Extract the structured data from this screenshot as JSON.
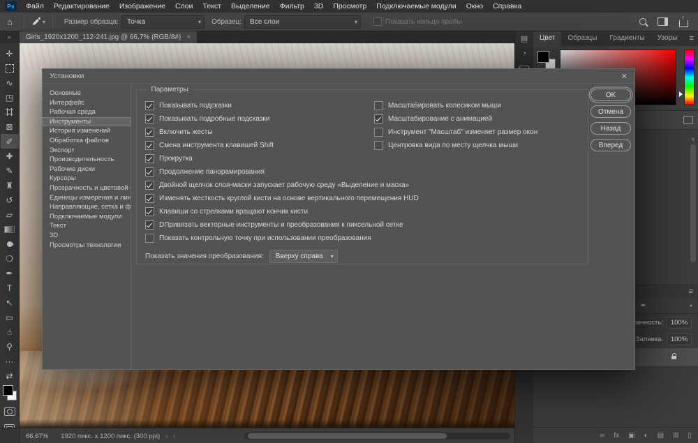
{
  "colors": {
    "accent_blue": "#34a9ff",
    "dialog_bg": "#535353",
    "selection_red": "#ff0000"
  },
  "icons": {
    "home": "⌂",
    "dropdown_arrow": "▾",
    "hamburger": "≡",
    "tab_overflow": "»",
    "scroll_up": "∧",
    "chevron_right": "›",
    "chevron_left": "‹",
    "dock_icon_1": "▤",
    "dock_icon_2": "◔",
    "filter_pin": "●"
  },
  "menu_bar": {
    "logo": "Ps",
    "items": [
      {
        "name": "menu-file",
        "label": "Файл"
      },
      {
        "name": "menu-edit",
        "label": "Редактирование"
      },
      {
        "name": "menu-image",
        "label": "Изображение"
      },
      {
        "name": "menu-layers",
        "label": "Слои"
      },
      {
        "name": "menu-type",
        "label": "Текст"
      },
      {
        "name": "menu-select",
        "label": "Выделение"
      },
      {
        "name": "menu-filter",
        "label": "Фильтр"
      },
      {
        "name": "menu-3d",
        "label": "3D"
      },
      {
        "name": "menu-view",
        "label": "Просмотр"
      },
      {
        "name": "menu-plugins",
        "label": "Подключаемые модули"
      },
      {
        "name": "menu-window",
        "label": "Окно"
      },
      {
        "name": "menu-help",
        "label": "Справка"
      }
    ]
  },
  "options_bar": {
    "sample_size_label": "Размер образца:",
    "sample_size_value": "Точка",
    "sample_label": "Образец:",
    "sample_value": "Все слои",
    "show_ring_label": "Показать кольцо пробы"
  },
  "tab_bar": {
    "document_title": "Girls_1920x1200_112-241.jpg @ 66,7% (RGB/8#)",
    "close": "×"
  },
  "toolbar": {
    "tools": [
      {
        "name": "move-tool",
        "glyph": "✛"
      },
      {
        "name": "marquee-tool",
        "glyph": "",
        "cls": "i-marquee"
      },
      {
        "name": "lasso-tool",
        "glyph": "∿"
      },
      {
        "name": "object-selection-tool",
        "glyph": "◳"
      },
      {
        "name": "crop-tool",
        "glyph": "",
        "cls": "i-crop"
      },
      {
        "name": "frame-tool",
        "glyph": "⊠"
      },
      {
        "name": "eyedropper-tool",
        "glyph": "✐",
        "active": true
      },
      {
        "name": "healing-brush-tool",
        "glyph": "✚"
      },
      {
        "name": "brush-tool",
        "glyph": "✎"
      },
      {
        "name": "clone-stamp-tool",
        "glyph": "♜"
      },
      {
        "name": "history-brush-tool",
        "glyph": "↺"
      },
      {
        "name": "eraser-tool",
        "glyph": "▱"
      },
      {
        "name": "gradient-tool",
        "glyph": "",
        "cls": "i-gradient"
      },
      {
        "name": "blur-tool",
        "glyph": "",
        "cls": "i-droplet"
      },
      {
        "name": "dodge-tool",
        "glyph": "❍"
      },
      {
        "name": "pen-tool",
        "glyph": "✒"
      },
      {
        "name": "type-tool",
        "glyph": "T"
      },
      {
        "name": "path-selection-tool",
        "glyph": "↖"
      },
      {
        "name": "shape-tool",
        "glyph": "▭"
      },
      {
        "name": "hand-tool",
        "glyph": "☝"
      },
      {
        "name": "zoom-tool",
        "glyph": "⚲"
      },
      {
        "name": "more-tools",
        "glyph": "···",
        "cls": "i-small"
      },
      {
        "name": "swap-colors",
        "glyph": "⇄",
        "cls": "i-small"
      }
    ]
  },
  "dialog": {
    "title": "Установки",
    "close": "✕",
    "sidebar": [
      {
        "name": "prefs-general",
        "label": "Основные"
      },
      {
        "name": "prefs-interface",
        "label": "Интерфейс"
      },
      {
        "name": "prefs-workspace",
        "label": "Рабочая среда"
      },
      {
        "name": "prefs-tools",
        "label": "Инструменты",
        "selected": true
      },
      {
        "name": "prefs-history",
        "label": "История изменений"
      },
      {
        "name": "prefs-file-handling",
        "label": "Обработка файлов"
      },
      {
        "name": "prefs-export",
        "label": "Экспорт"
      },
      {
        "name": "prefs-performance",
        "label": "Производительность"
      },
      {
        "name": "prefs-scratch-disks",
        "label": "Рабочие диски"
      },
      {
        "name": "prefs-cursors",
        "label": "Курсоры"
      },
      {
        "name": "prefs-transparency-gamut",
        "label": "Прозрачность и цветовой охват"
      },
      {
        "name": "prefs-units-rulers",
        "label": "Единицы измерения и линейки"
      },
      {
        "name": "prefs-guides-grid-slices",
        "label": "Направляющие, сетка и фрагменты"
      },
      {
        "name": "prefs-plugins",
        "label": "Подключаемые модули"
      },
      {
        "name": "prefs-type",
        "label": "Текст"
      },
      {
        "name": "prefs-3d",
        "label": "3D"
      },
      {
        "name": "prefs-tech-previews",
        "label": "Просмотры технологии"
      }
    ],
    "group_label": "Параметры",
    "options_left": [
      {
        "name": "opt-show-tooltips",
        "label": "Показывать подсказки",
        "checked": true
      },
      {
        "name": "opt-show-rich-tooltips",
        "label": "Показывать подробные подсказки",
        "checked": true
      },
      {
        "name": "opt-enable-gestures",
        "label": "Включить жесты",
        "checked": true
      },
      {
        "name": "opt-shift-tool-switch",
        "label": "Смена инструмента клавишей Shift",
        "checked": true
      },
      {
        "name": "opt-overscroll",
        "label": "Прокрутка",
        "checked": true
      },
      {
        "name": "opt-flick-panning",
        "label": "Продолжение панорамирования",
        "checked": true
      },
      {
        "name": "opt-doubleclick-mask",
        "label": "Двойной щелчок слоя-маски запускает рабочую среду «Выделение и маска»",
        "checked": true
      },
      {
        "name": "opt-hud-hardness",
        "label": "Изменять жесткость круглой кисти на основе вертикального перемещения HUD",
        "checked": true
      },
      {
        "name": "opt-arrow-keys-rotate",
        "label": "Клавиши со стрелками вращают кончик кисти",
        "checked": true
      },
      {
        "name": "opt-snap-vector",
        "label": "DПривязать векторные инструменты и преобразования к пиксельной сетке",
        "checked": true
      },
      {
        "name": "opt-show-reference-point",
        "label": "Показать контрольную точку при использовании преобразования",
        "checked": false
      }
    ],
    "options_right": [
      {
        "name": "opt-zoom-scroll-wheel",
        "label": "Масштабировать колесиком мыши",
        "checked": false
      },
      {
        "name": "opt-animated-zoom",
        "label": "Масштабирование с анимацией",
        "checked": true
      },
      {
        "name": "opt-zoom-resizes-windows",
        "label": "Инструмент \"Масштаб\" изменяет размер окон",
        "checked": false
      },
      {
        "name": "opt-zoom-clicked-point",
        "label": "Центровка вида по месту щелчка мыши",
        "checked": false
      }
    ],
    "transform_label": "Показать значения преобразования:",
    "transform_value": "Вверху справа",
    "buttons": [
      {
        "name": "ok-button",
        "label": "OK",
        "focused": true
      },
      {
        "name": "cancel-button",
        "label": "Отмена"
      },
      {
        "name": "prev-button",
        "label": "Назад"
      },
      {
        "name": "next-button",
        "label": "Вперед"
      }
    ]
  },
  "right_panel": {
    "tabs": [
      {
        "name": "tab-color",
        "label": "Цвет",
        "active": true
      },
      {
        "name": "tab-swatches",
        "label": "Образцы"
      },
      {
        "name": "tab-gradients",
        "label": "Градиенты"
      },
      {
        "name": "tab-patterns",
        "label": "Узоры"
      }
    ],
    "layers": {
      "filter_icons": [
        {
          "name": "filter-type-icon",
          "glyph": "T"
        },
        {
          "name": "filter-shape-icon",
          "glyph": "▭"
        },
        {
          "name": "filter-pen-icon",
          "glyph": "✒"
        }
      ],
      "opacity_label": "Непрозрачность:",
      "opacity_value": "100%",
      "fill_label": "Заливка:",
      "fill_value": "100%",
      "bottom_icons": [
        {
          "name": "link-layers-icon",
          "glyph": "∞"
        },
        {
          "name": "layer-effects-icon",
          "glyph": "fx"
        },
        {
          "name": "layer-mask-icon",
          "glyph": "▣"
        },
        {
          "name": "adjustment-layer-icon",
          "glyph": "◐"
        },
        {
          "name": "layer-group-icon",
          "glyph": "▤"
        },
        {
          "name": "new-layer-icon",
          "glyph": "⊞"
        },
        {
          "name": "delete-layer-icon",
          "glyph": "▯"
        }
      ]
    }
  },
  "status_bar": {
    "zoom": "66,67%",
    "doc_info": "1920 пикс. x 1200 пикс. (300 ppi)"
  }
}
